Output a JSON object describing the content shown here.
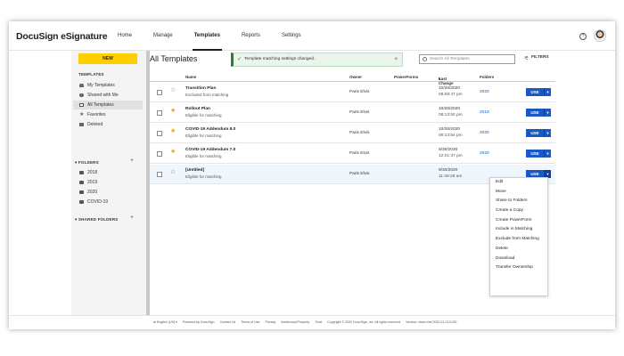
{
  "header": {
    "logo": "DocuSign eSignature",
    "nav": [
      "Home",
      "Manage",
      "Templates",
      "Reports",
      "Settings"
    ],
    "active_nav": "Templates",
    "help_icon": "?"
  },
  "sidebar": {
    "new_label": "NEW",
    "templates_heading": "TEMPLATES",
    "items": [
      {
        "label": "My Templates",
        "icon": "person-icon"
      },
      {
        "label": "Shared with Me",
        "icon": "people-icon"
      },
      {
        "label": "All Templates",
        "icon": "document-icon"
      },
      {
        "label": "Favorites",
        "icon": "star-icon"
      },
      {
        "label": "Deleted",
        "icon": "trash-icon"
      }
    ],
    "folders_heading": "FOLDERS",
    "folders": [
      "2018",
      "2019",
      "2020",
      "COVID-19"
    ],
    "shared_folders_heading": "SHARED FOLDERS"
  },
  "main": {
    "title": "All Templates",
    "toast": "Template matching settings changed.",
    "search_placeholder": "Search All Templates",
    "filters_label": "FILTERS",
    "columns": {
      "name": "Name",
      "owner": "Owner",
      "powerforms": "PowerForms",
      "last_change": "Last Change",
      "folders": "Folders"
    },
    "rows": [
      {
        "name": "Transition Plan",
        "status": "Excluded from matching",
        "owner": "Paris Elvis",
        "date": "10/26/2020",
        "time": "09:09:47 pm",
        "folder": "2020",
        "favorite": false
      },
      {
        "name": "Rollout Plan",
        "status": "Eligible for matching",
        "owner": "Paris Elvis",
        "date": "10/26/2020",
        "time": "08:13:50 pm",
        "folder": "2018",
        "favorite": true
      },
      {
        "name": "COVID-19 Addendum 8.0",
        "status": "Eligible for matching",
        "owner": "Paris Elvis",
        "date": "10/26/2020",
        "time": "08:13:54 pm",
        "folder": "2020",
        "favorite": true
      },
      {
        "name": "COVID-19 Addendum 7.0",
        "status": "Eligible for matching",
        "owner": "Paris Elvis",
        "date": "9/30/2020",
        "time": "12:01:37 pm",
        "folder": "2020",
        "favorite": true
      },
      {
        "name": "[Untitled]",
        "status": "Eligible for matching",
        "owner": "Paris Elvis",
        "date": "9/30/2020",
        "time": "11:48:28 am",
        "folder": "",
        "favorite": false
      }
    ],
    "use_label": "USE"
  },
  "menu": [
    "Edit",
    "Move",
    "Share to Folders",
    "Create a Copy",
    "Create PowerForm",
    "Include in Matching",
    "Exclude from Matching",
    "Delete",
    "Download",
    "Transfer Ownership"
  ],
  "footer": {
    "language": "English (US)",
    "links": [
      "Powered by DocuSign",
      "Contact Us",
      "Terms of Use",
      "Privacy",
      "Intellectual Property",
      "Trust",
      "Copyright © 2020 DocuSign, Inc. All rights reserved",
      "Version: vbwe.rhel.2020.21.213.030"
    ]
  },
  "colors": {
    "accent_blue": "#1958c8",
    "new_button_yellow": "#ffce00",
    "favorite_star": "#f0a500",
    "toast_green": "#2e7d32"
  }
}
